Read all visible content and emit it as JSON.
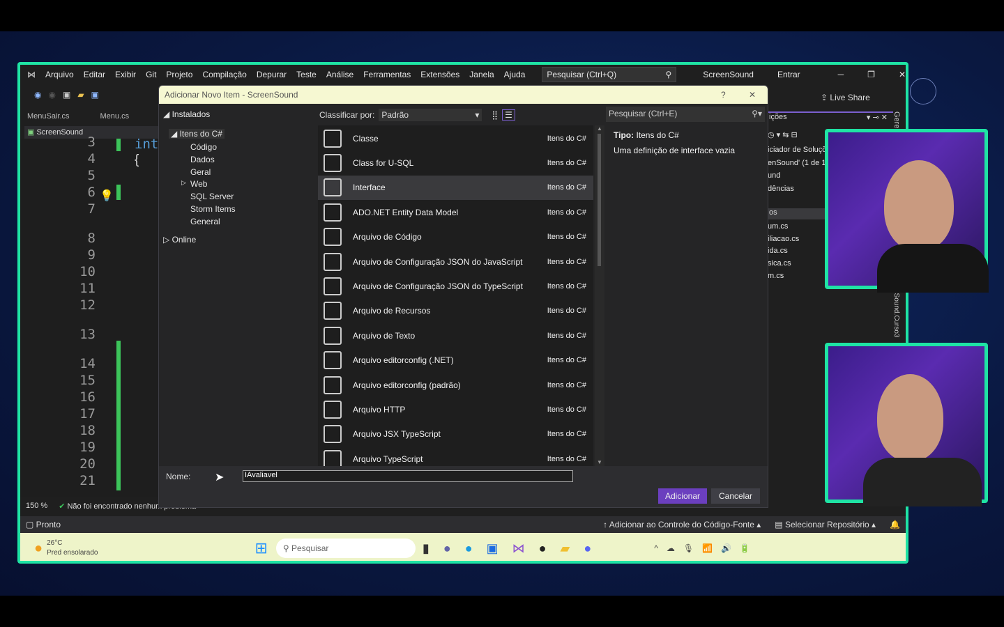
{
  "menu": [
    "Arquivo",
    "Editar",
    "Exibir",
    "Git",
    "Projeto",
    "Compilação",
    "Depurar",
    "Teste",
    "Análise",
    "Ferramentas",
    "Extensões",
    "Janela",
    "Ajuda"
  ],
  "vs_search": "Pesquisar (Ctrl+Q)",
  "solution_name": "ScreenSound",
  "signin": "Entrar",
  "live_share": "Live Share",
  "editor_tabs": [
    "MenuSair.cs",
    "Menu.cs"
  ],
  "project_label": "ScreenSound",
  "line_numbers": [
    "3",
    "4",
    "5",
    "6",
    "7",
    "8",
    "9",
    "10",
    "11",
    "12",
    "13",
    "14",
    "15",
    "16",
    "17",
    "18",
    "19",
    "20",
    "21"
  ],
  "code_fragment": "int",
  "zoom_level": "150 %",
  "problems": "Não foi encontrado nenhum problema",
  "status": {
    "ready": "Pronto",
    "source_control": "Adicionar ao Controle do Código-Fonte",
    "repo": "Selecionar Repositório"
  },
  "taskbar": {
    "temp": "26°C",
    "weather": "Pred ensolarado",
    "search": "Pesquisar"
  },
  "dialog": {
    "title": "Adicionar Novo Item - ScreenSound",
    "help": "?",
    "close": "✕",
    "tree": {
      "installed": "Instalados",
      "csharp": "Itens do C#",
      "children": [
        "Código",
        "Dados",
        "Geral",
        "Web",
        "SQL Server",
        "Storm Items",
        "General"
      ],
      "online": "Online"
    },
    "sort_label": "Classificar por:",
    "sort_value": "Padrão",
    "search_placeholder": "Pesquisar (Ctrl+E)",
    "items": [
      {
        "name": "Classe",
        "category": "Itens do C#",
        "icon": "class-icon"
      },
      {
        "name": "Class for U-SQL",
        "category": "Itens do C#",
        "icon": "class-icon"
      },
      {
        "name": "Interface",
        "category": "Itens do C#",
        "icon": "interface-icon",
        "selected": true
      },
      {
        "name": "ADO.NET Entity Data Model",
        "category": "Itens do C#",
        "icon": "entity-model-icon"
      },
      {
        "name": "Arquivo de Código",
        "category": "Itens do C#",
        "icon": "code-file-icon"
      },
      {
        "name": "Arquivo de Configuração JSON do JavaScript",
        "category": "Itens do C#",
        "icon": "json-config-icon"
      },
      {
        "name": "Arquivo de Configuração JSON do TypeScript",
        "category": "Itens do C#",
        "icon": "json-config-icon"
      },
      {
        "name": "Arquivo de Recursos",
        "category": "Itens do C#",
        "icon": "resource-file-icon"
      },
      {
        "name": "Arquivo de Texto",
        "category": "Itens do C#",
        "icon": "text-file-icon"
      },
      {
        "name": "Arquivo editorconfig (.NET)",
        "category": "Itens do C#",
        "icon": "editorconfig-icon"
      },
      {
        "name": "Arquivo editorconfig (padrão)",
        "category": "Itens do C#",
        "icon": "editorconfig-icon"
      },
      {
        "name": "Arquivo HTTP",
        "category": "Itens do C#",
        "icon": "http-file-icon"
      },
      {
        "name": "Arquivo JSX TypeScript",
        "category": "Itens do C#",
        "icon": "typescript-file-icon"
      },
      {
        "name": "Arquivo TypeScript",
        "category": "Itens do C#",
        "icon": "typescript-file-icon"
      }
    ],
    "type_label": "Tipo:",
    "type_value": "Itens do C#",
    "description": "Uma definição de interface vazia",
    "name_label": "Nome:",
    "name_value": "IAvaliavel",
    "add": "Adicionar",
    "cancel": "Cancelar"
  },
  "solution_explorer": {
    "title": "ições",
    "lines": [
      "iciador de Soluçõ",
      "enSound' (1 de 1",
      "und",
      "dências"
    ],
    "section": "os",
    "files": [
      "um.cs",
      "iliacao.cs",
      "ida.cs",
      "sica.cs",
      "m.cs"
    ],
    "side_tab": "Gere",
    "side_tab2": "nSound.Curso3"
  },
  "colors": {
    "accent": "#1fe3a4",
    "vs_purple": "#5c2d91",
    "button": "#6b3fbf"
  }
}
